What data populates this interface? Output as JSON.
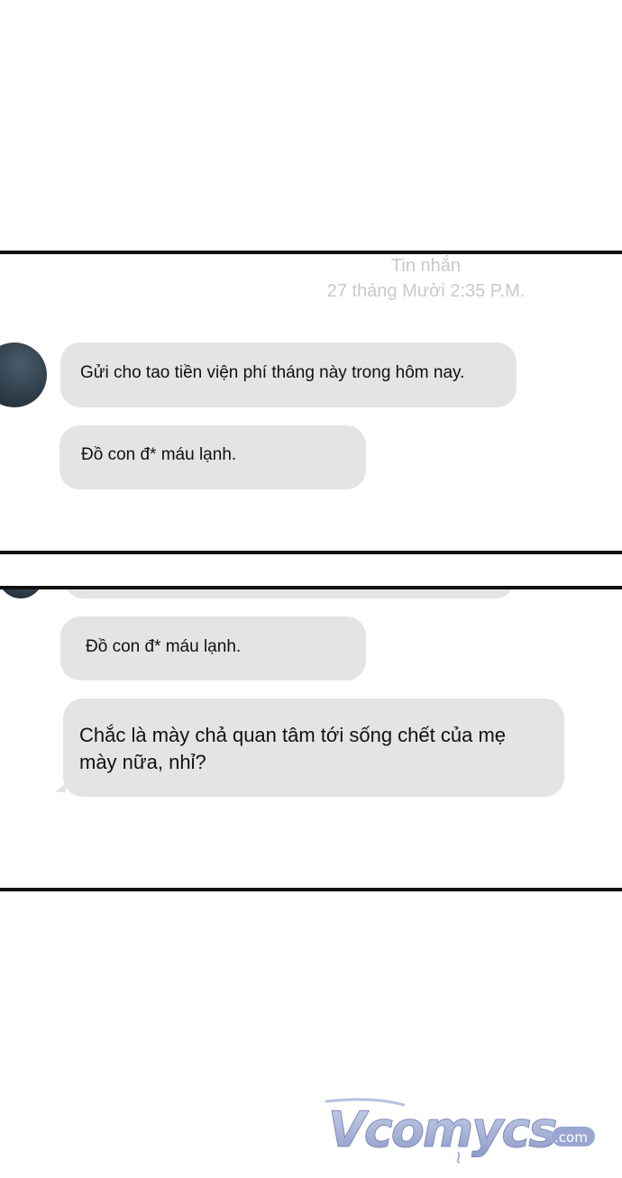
{
  "conversation_1": {
    "header_label": "Tin nhắn",
    "timestamp": "27 tháng Mười 2:35 P.M.",
    "messages": [
      "Gửi cho tao tiền viện phí tháng này trong hôm nay.",
      "Đồ con đ* máu lạnh."
    ]
  },
  "conversation_2": {
    "messages": [
      "Đồ con đ* máu lạnh.",
      "Chắc là mày chả quan tâm tới sống chết của mẹ mày nữa, nhỉ?"
    ]
  },
  "watermark": {
    "text": "Vcomycs",
    "suffix": ".com"
  },
  "colors": {
    "bubble": "#e4e4e4",
    "rule": "#111111",
    "header_text": "#c9c9c9",
    "watermark": "#a9b4d6"
  },
  "icons": {
    "avatar": "contact-avatar"
  }
}
